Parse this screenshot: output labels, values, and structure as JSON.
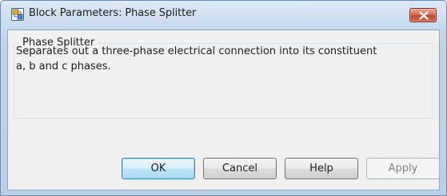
{
  "window": {
    "title": "Block Parameters: Phase Splitter"
  },
  "icons": {
    "app": "simulink-block-icon",
    "close": "close-icon"
  },
  "group": {
    "title": "Phase Splitter",
    "description_lines": [
      "Separates out a three-phase electrical connection into its constituent",
      "a, b and c phases."
    ]
  },
  "buttons": {
    "ok": "OK",
    "cancel": "Cancel",
    "help": "Help",
    "apply": "Apply"
  },
  "colors": {
    "close_button": "#c14a31",
    "default_button_border": "#3c7fb1",
    "disabled_text": "#838383"
  }
}
